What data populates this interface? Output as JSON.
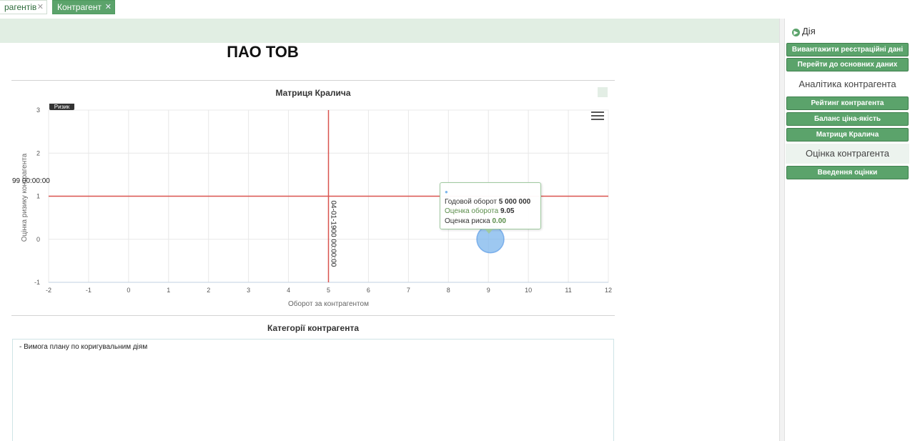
{
  "tabs": [
    {
      "label": "рагентів",
      "close": "✕"
    },
    {
      "label": "Контрагент",
      "close": "✕"
    }
  ],
  "page": {
    "company_name": "ПАО ТОВ",
    "chart_section_title": "Матриця Кралича",
    "categories_title": "Категорії контрагента",
    "categories_text": "- Вимога плану по коригувальним діям"
  },
  "chart_data": {
    "type": "scatter",
    "title": "Матриця Кралича",
    "xlabel": "Оборот за контрагентом",
    "ylabel": "Оцінка ризику контрагента",
    "xlim": [
      -2,
      12
    ],
    "ylim": [
      -1,
      3
    ],
    "x_ticks": [
      -2,
      -1,
      0,
      1,
      2,
      3,
      4,
      5,
      6,
      7,
      8,
      9,
      10,
      11,
      12
    ],
    "y_ticks": [
      -1,
      0,
      1,
      2,
      3
    ],
    "grid": true,
    "legend": "top-right",
    "x_plotline": {
      "value": 5,
      "label": "04-01-1900 00:00:00",
      "color": "#d9534f"
    },
    "y_plotline": {
      "value": 1,
      "label": "99 00:00:00",
      "color": "#d9534f"
    },
    "corner_tag": "Ризик",
    "points": [
      {
        "x": 9.05,
        "y": 0,
        "color": "#7cb5ec"
      }
    ],
    "tooltip": {
      "line1_label": "Годовой оборот",
      "line1_value": "5 000 000",
      "line2_label": "Оценка оборота",
      "line2_value": "9.05",
      "line3_label": "Оценка риска",
      "line3_value": "0.00"
    }
  },
  "sidebar": {
    "action_header": "Дія",
    "action_buttons": [
      "Вивантажити реєстраційні дані",
      "Перейти до основних даних"
    ],
    "groups": [
      {
        "title": "Аналітика контрагента",
        "buttons": [
          "Рейтинг контрагента",
          "Баланс ціна-якість",
          "Матриця Кралича"
        ]
      },
      {
        "title": "Оцінка контрагента",
        "buttons": [
          "Введення оцінки"
        ]
      }
    ]
  }
}
